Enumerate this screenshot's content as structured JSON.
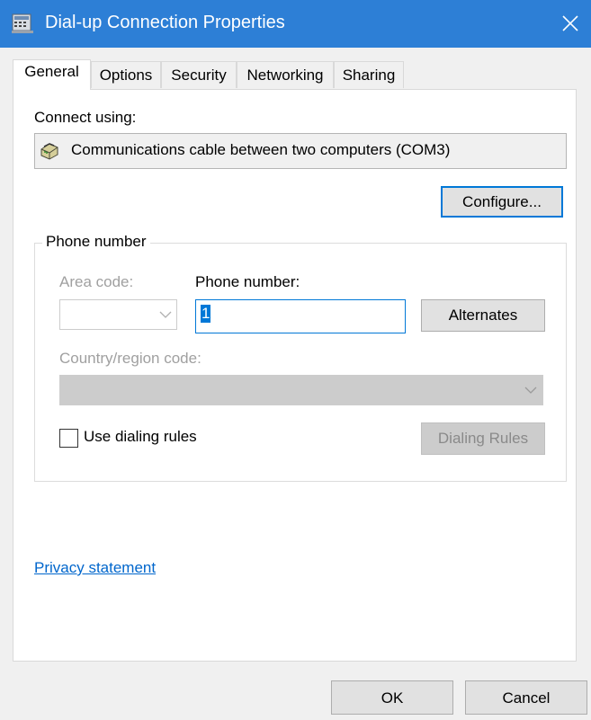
{
  "window": {
    "title": "Dial-up Connection Properties",
    "title_icon": "dialup-connection-icon",
    "close_icon": "close-icon",
    "titlebar_color": "#2d7fd6"
  },
  "tabs": [
    {
      "label": "General",
      "active": true
    },
    {
      "label": "Options"
    },
    {
      "label": "Security"
    },
    {
      "label": "Networking"
    },
    {
      "label": "Sharing"
    }
  ],
  "general": {
    "connect_using_label": "Connect using:",
    "device": {
      "name": "Communications cable between two computers (COM3)",
      "icon": "modem-icon"
    },
    "configure_button": "Configure...",
    "phone_group": {
      "title": "Phone number",
      "area_code_label": "Area code:",
      "area_code_value": "",
      "phone_number_label": "Phone number:",
      "phone_number_value": "1",
      "alternates_button": "Alternates",
      "country_label": "Country/region code:",
      "country_value": "",
      "use_dialing_rules_label": "Use dialing rules",
      "use_dialing_rules_checked": false,
      "dialing_rules_button": "Dialing Rules"
    },
    "privacy_link": "Privacy statement"
  },
  "footer": {
    "ok_button": "OK",
    "cancel_button": "Cancel"
  }
}
